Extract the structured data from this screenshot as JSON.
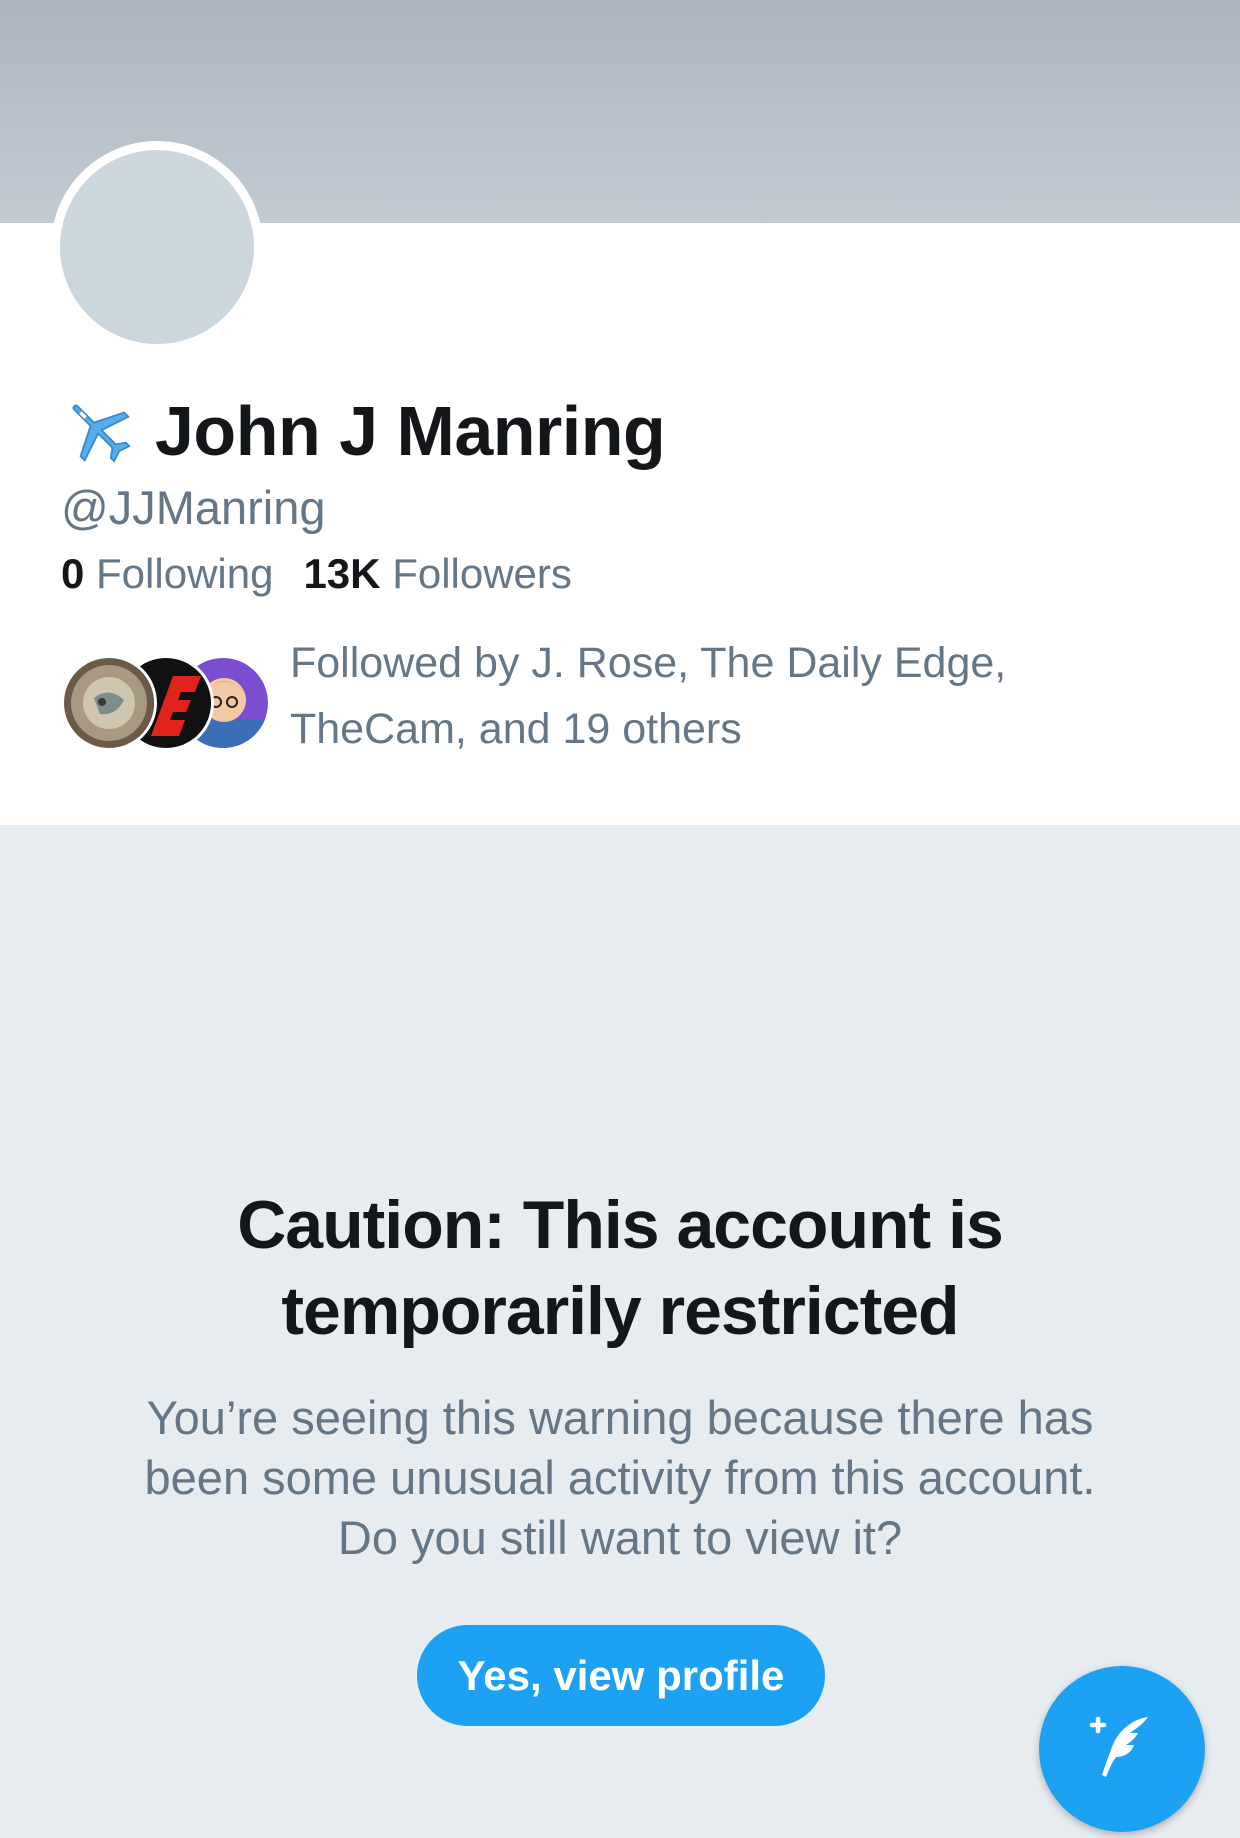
{
  "profile": {
    "name_icon": "airplane-icon",
    "display_name": "John J Manring",
    "handle": "@JJManring",
    "following_count": "0",
    "following_label": "Following",
    "followers_count": "13K",
    "followers_label": "Followers",
    "followed_by_text": "Followed by J. Rose, The Daily Edge, TheCam, and 19 others",
    "followed_by_avatars": [
      "follower-avatar-1",
      "follower-avatar-2",
      "follower-avatar-3"
    ]
  },
  "warning": {
    "title": "Caution: This account is temporarily restricted",
    "body": "You’re seeing this warning because there has been some unusual activity from this account. Do you still want to view it?",
    "button_label": "Yes, view profile"
  },
  "fab": {
    "icon": "compose-tweet-icon"
  },
  "colors": {
    "accent": "#1da1f2",
    "text_primary": "#14171a",
    "text_secondary": "#657786",
    "background": "#e6ecf0",
    "avatar_placeholder": "#ccd6dd"
  }
}
